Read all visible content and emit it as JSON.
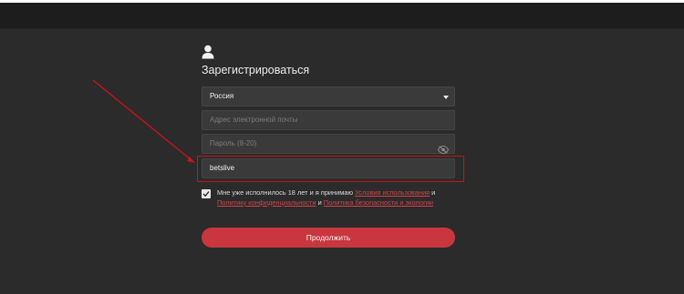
{
  "form": {
    "title": "Зарегистрироваться",
    "country": {
      "selected": "Россия"
    },
    "email": {
      "placeholder": "Адрес электронной почты",
      "value": ""
    },
    "password": {
      "placeholder": "Пароль (8-20)",
      "value": ""
    },
    "promo": {
      "value": "betslive"
    },
    "consent": {
      "checked": true,
      "text_prefix": "Мне уже исполнилось 18 лет и я принимаю ",
      "link_terms": "Условия использования",
      "and_1": " и ",
      "link_privacy": "Политику конфиденциальности",
      "and_2": " и ",
      "link_safety": "Политика безопасности и экологии"
    },
    "submit_label": "Продолжить"
  },
  "colors": {
    "accent": "#c9363e",
    "highlight": "#c8141b",
    "background": "#2b2b2b"
  },
  "icons": [
    "user-icon",
    "caret-down-icon",
    "eye-slash-icon",
    "checkmark-icon",
    "arrow-annotation"
  ]
}
